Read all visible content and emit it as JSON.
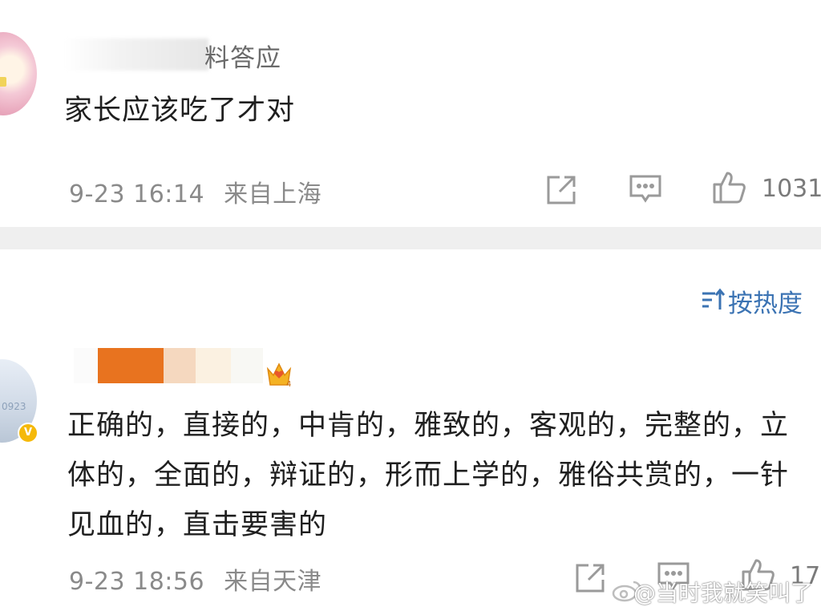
{
  "comment1": {
    "username_visible": "料答应",
    "text": "家长应该吃了才对",
    "time": "9-23 16:14",
    "location": "来自上海",
    "like_count": "1031"
  },
  "sort": {
    "label": "按热度"
  },
  "comment2": {
    "avatar_text": "0923",
    "text": "正确的，直接的，中肯的，雅致的，客观的，完整的，立体的，全面的，辩证的，形而上学的，雅俗共赏的，一针见血的，直击要害的",
    "time": "9-23 18:56",
    "location": "来自天津",
    "like_count": "17"
  },
  "watermark": {
    "text": "@当时我就笑叫了"
  },
  "colors": {
    "link_blue": "#3b73b3",
    "meta_gray": "#8a8a8a",
    "divider": "#efefef",
    "name_orange": "#e8731f"
  },
  "icons": [
    "repost-icon",
    "comment-icon",
    "like-icon",
    "sort-icon",
    "crown-icon",
    "verified-icon",
    "weibo-logo-icon"
  ]
}
